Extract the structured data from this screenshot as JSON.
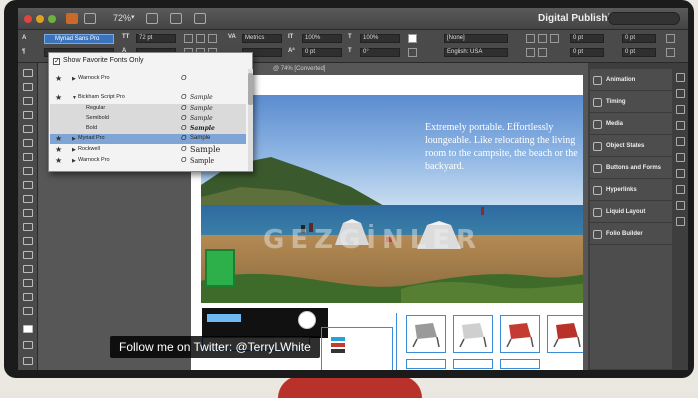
{
  "app_bar": {
    "zoom": "72%",
    "workspace": "Digital Publishing"
  },
  "control_panel": {
    "font_family": "Myriad Sans Pro",
    "font_size": "72 pt",
    "leading": "Metrics",
    "tracking_percent": "100%",
    "scale_percent": "100%",
    "baseline": "0 pt",
    "angle": "0°",
    "style": "[None]",
    "language": "English: USA",
    "indent_values": [
      "0 pt",
      "0 pt",
      "0 pt",
      "0 pt"
    ]
  },
  "document": {
    "tab_label": "@ 74% [Converted]",
    "headline": "Extremely portable. Effortlessly loungeable. Like relocating the living room to the campsite, the beach or the backyard.",
    "watermark": "GEZGİNLER"
  },
  "font_menu": {
    "show_favorites_label": "Show Favorite Fonts Only",
    "show_favorites_checked": true,
    "rows": [
      {
        "name": "Warnock Pro",
        "starred": true,
        "expander": "▶",
        "type": "O",
        "sample": ""
      },
      {
        "name": "Bickham Script Pro",
        "starred": true,
        "expander": "▼",
        "type": "O",
        "sample": "Sample"
      },
      {
        "name": "Regular",
        "starred": false,
        "expander": "",
        "type": "O",
        "sample": "Sample"
      },
      {
        "name": "Semibold",
        "starred": false,
        "expander": "",
        "type": "O",
        "sample": "Sample"
      },
      {
        "name": "Bold",
        "starred": false,
        "expander": "",
        "type": "O",
        "sample": "Sample"
      },
      {
        "name": "Myriad Pro",
        "starred": true,
        "expander": "▶",
        "type": "O",
        "sample": "Sample",
        "selected": true
      },
      {
        "name": "Rockwell",
        "starred": true,
        "expander": "▶",
        "type": "O",
        "sample": "Sample"
      },
      {
        "name": "Warnock Pro",
        "starred": true,
        "expander": "▶",
        "type": "O",
        "sample": "Sample"
      }
    ]
  },
  "right_panel": {
    "items": [
      "Animation",
      "Timing",
      "Media",
      "Object States",
      "Buttons and Forms",
      "Hyperlinks",
      "Liquid Layout",
      "Folio Builder"
    ]
  },
  "caption": "Follow me on Twitter: @TerryLWhite",
  "colors": {
    "selection": "#7fa4d6",
    "accent_blue": "#3b8bd6",
    "monitor_stand": "#b8322b",
    "green_box": "#2db04a"
  }
}
